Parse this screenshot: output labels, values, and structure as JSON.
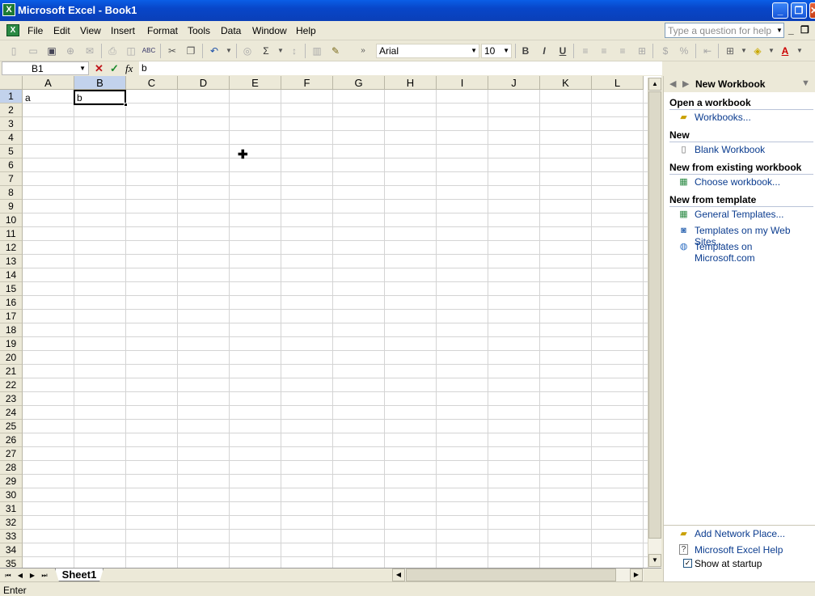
{
  "window": {
    "title": "Microsoft Excel - Book1",
    "app_icon": "X",
    "controls": {
      "minimize": "_",
      "restore": "❐",
      "close": "✕"
    }
  },
  "menubar": {
    "items": [
      "File",
      "Edit",
      "View",
      "Insert",
      "Format",
      "Tools",
      "Data",
      "Window",
      "Help"
    ],
    "help_placeholder": "Type a question for help",
    "mdi_minimize": "_",
    "mdi_restore": "❐"
  },
  "toolbar": {
    "font": "Arial",
    "size": "10",
    "bold": "B",
    "italic": "I",
    "underline": "U",
    "autosum": "Σ"
  },
  "formula_bar": {
    "name_box": "B1",
    "cancel": "✕",
    "enter": "✓",
    "fx": "fx",
    "content": "b"
  },
  "grid": {
    "columns": [
      "A",
      "B",
      "C",
      "D",
      "E",
      "F",
      "G",
      "H",
      "I",
      "J",
      "K",
      "L"
    ],
    "selected_column": "B",
    "rows": [
      "1",
      "2",
      "3",
      "4",
      "5",
      "6",
      "7",
      "8",
      "9",
      "10",
      "11",
      "12",
      "13",
      "14",
      "15",
      "16",
      "17",
      "18",
      "19",
      "20",
      "21",
      "22",
      "23",
      "24",
      "25",
      "26",
      "27",
      "28",
      "29",
      "30",
      "31",
      "32",
      "33",
      "34",
      "35"
    ],
    "selected_row": "1",
    "cells": {
      "A1": "a",
      "B1": "b"
    }
  },
  "sheets": {
    "tabs": [
      "Sheet1"
    ],
    "active": "Sheet1"
  },
  "status": {
    "text": "Enter"
  },
  "taskpane": {
    "title": "New Workbook",
    "sections": [
      {
        "heading": "Open a workbook",
        "links": [
          {
            "label": "Workbooks...",
            "icon": "folder-icon"
          }
        ]
      },
      {
        "heading": "New",
        "links": [
          {
            "label": "Blank Workbook",
            "icon": "blank-doc-icon"
          }
        ]
      },
      {
        "heading": "New from existing workbook",
        "links": [
          {
            "label": "Choose workbook...",
            "icon": "workbook-icon"
          }
        ]
      },
      {
        "heading": "New from template",
        "links": [
          {
            "label": "General Templates...",
            "icon": "template-icon"
          },
          {
            "label": "Templates on my Web Sites...",
            "icon": "web-template-icon"
          },
          {
            "label": "Templates on Microsoft.com",
            "icon": "globe-icon"
          }
        ]
      }
    ],
    "footer": {
      "add_network_place": "Add Network Place...",
      "excel_help": "Microsoft Excel Help",
      "show_at_startup": "Show at startup",
      "show_at_startup_checked": true
    }
  }
}
